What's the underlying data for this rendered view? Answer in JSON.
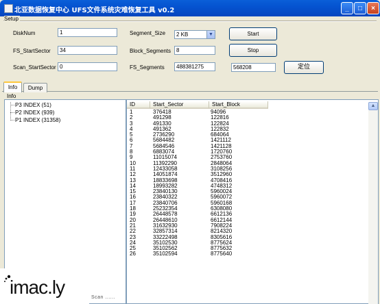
{
  "window": {
    "title": "北亚数据恢复中心 UFS文件系统灾难恢复工具 v0.2",
    "controls": {
      "minimize": "_",
      "maximize": "□",
      "close": "×"
    }
  },
  "setup": {
    "label": "Setup",
    "disknum_label": "DiskNum",
    "disknum_value": "1",
    "fs_startsector_label": "FS_StartSector",
    "fs_startsector_value": "34",
    "scan_startsector_label": "Scan_StartSector",
    "scan_startsector_value": "0",
    "segment_size_label": "Segment_Size",
    "segment_size_value": "2 KB",
    "block_segments_label": "Block_Segments",
    "block_segments_value": "8",
    "fs_segments_label": "FS_Segments",
    "fs_segments_value": "488381275",
    "locate_value": "568208",
    "start_button": "Start",
    "stop_button": "Stop",
    "locate_button": "定位"
  },
  "tabs": [
    {
      "label": "Info",
      "active": true
    },
    {
      "label": "Dump",
      "active": false
    }
  ],
  "info_label": "Info",
  "tree": [
    {
      "label": "P3 INDEX (51)"
    },
    {
      "label": "P2 INDEX (939)"
    },
    {
      "label": "P1 INDEX (31358)"
    }
  ],
  "table": {
    "columns": [
      "ID",
      "Start_Sector",
      "Start_Block"
    ],
    "rows": [
      [
        "1",
        "376418",
        "94096"
      ],
      [
        "2",
        "491298",
        "122816"
      ],
      [
        "3",
        "491330",
        "122824"
      ],
      [
        "4",
        "491362",
        "122832"
      ],
      [
        "5",
        "2736290",
        "684064"
      ],
      [
        "6",
        "5684482",
        "1421112"
      ],
      [
        "7",
        "5684546",
        "1421128"
      ],
      [
        "8",
        "6883074",
        "1720760"
      ],
      [
        "9",
        "11015074",
        "2753760"
      ],
      [
        "10",
        "11392290",
        "2848064"
      ],
      [
        "11",
        "12433058",
        "3108256"
      ],
      [
        "12",
        "14051874",
        "3512960"
      ],
      [
        "13",
        "18833698",
        "4708416"
      ],
      [
        "14",
        "18993282",
        "4748312"
      ],
      [
        "15",
        "23840130",
        "5960024"
      ],
      [
        "16",
        "23840322",
        "5960072"
      ],
      [
        "17",
        "23840706",
        "5960168"
      ],
      [
        "18",
        "25232354",
        "6308080"
      ],
      [
        "19",
        "26448578",
        "6612136"
      ],
      [
        "20",
        "26448610",
        "6612144"
      ],
      [
        "21",
        "31632930",
        "7908224"
      ],
      [
        "22",
        "32857314",
        "8214320"
      ],
      [
        "23",
        "33222498",
        "8305616"
      ],
      [
        "24",
        "35102530",
        "8775624"
      ],
      [
        "25",
        "35102562",
        "8775632"
      ],
      [
        "26",
        "35102594",
        "8775640"
      ]
    ]
  },
  "status": "Scan ......",
  "watermark": "imac.ly"
}
